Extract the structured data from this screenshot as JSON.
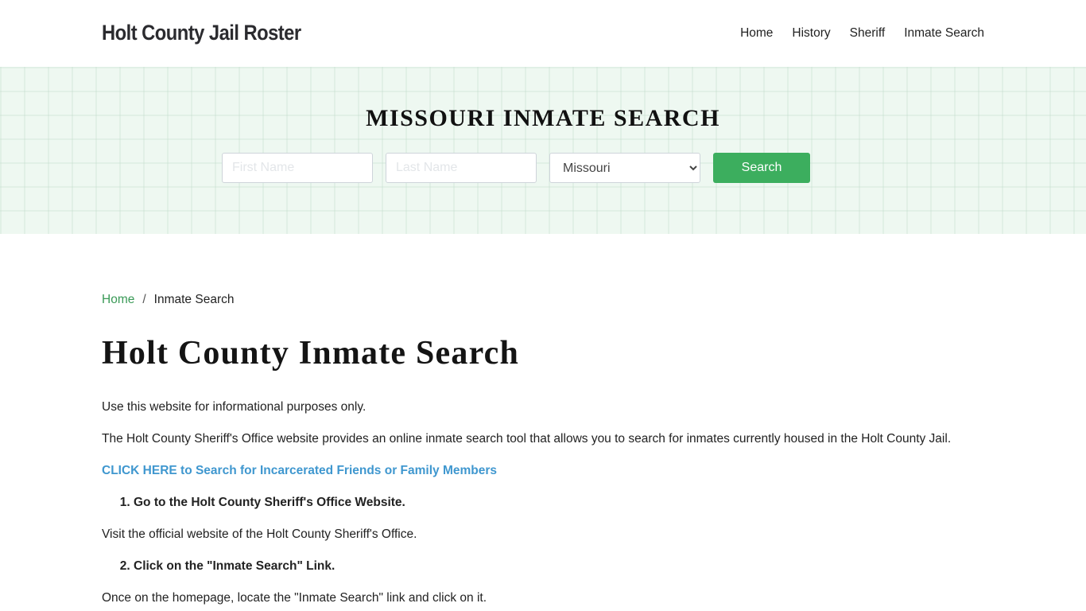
{
  "header": {
    "brand": "Holt County Jail Roster",
    "nav": [
      "Home",
      "History",
      "Sheriff",
      "Inmate Search"
    ]
  },
  "hero": {
    "title": "MISSOURI INMATE SEARCH",
    "first_name_placeholder": "First Name",
    "last_name_placeholder": "Last Name",
    "state_selected": "Missouri",
    "search_label": "Search"
  },
  "breadcrumb": {
    "home": "Home",
    "separator": "/",
    "current": "Inmate Search"
  },
  "main": {
    "title": "Holt County Inmate Search",
    "intro": "Use this website for informational purposes only.",
    "description": "The Holt County Sheriff's Office website provides an online inmate search tool that allows you to search for inmates currently housed in the Holt County Jail.",
    "cta": "CLICK HERE to Search for Incarcerated Friends or Family Members",
    "step1": "Go to the Holt County Sheriff's Office Website.",
    "step1_text": "Visit the official website of the Holt County Sheriff's Office.",
    "step2": "Click on the \"Inmate Search\" Link.",
    "step2_text": "Once on the homepage, locate the \"Inmate Search\" link and click on it."
  },
  "colors": {
    "accent_green": "#3cae5e",
    "link_blue": "#3f97cf",
    "hero_bg": "#eef8f1"
  }
}
